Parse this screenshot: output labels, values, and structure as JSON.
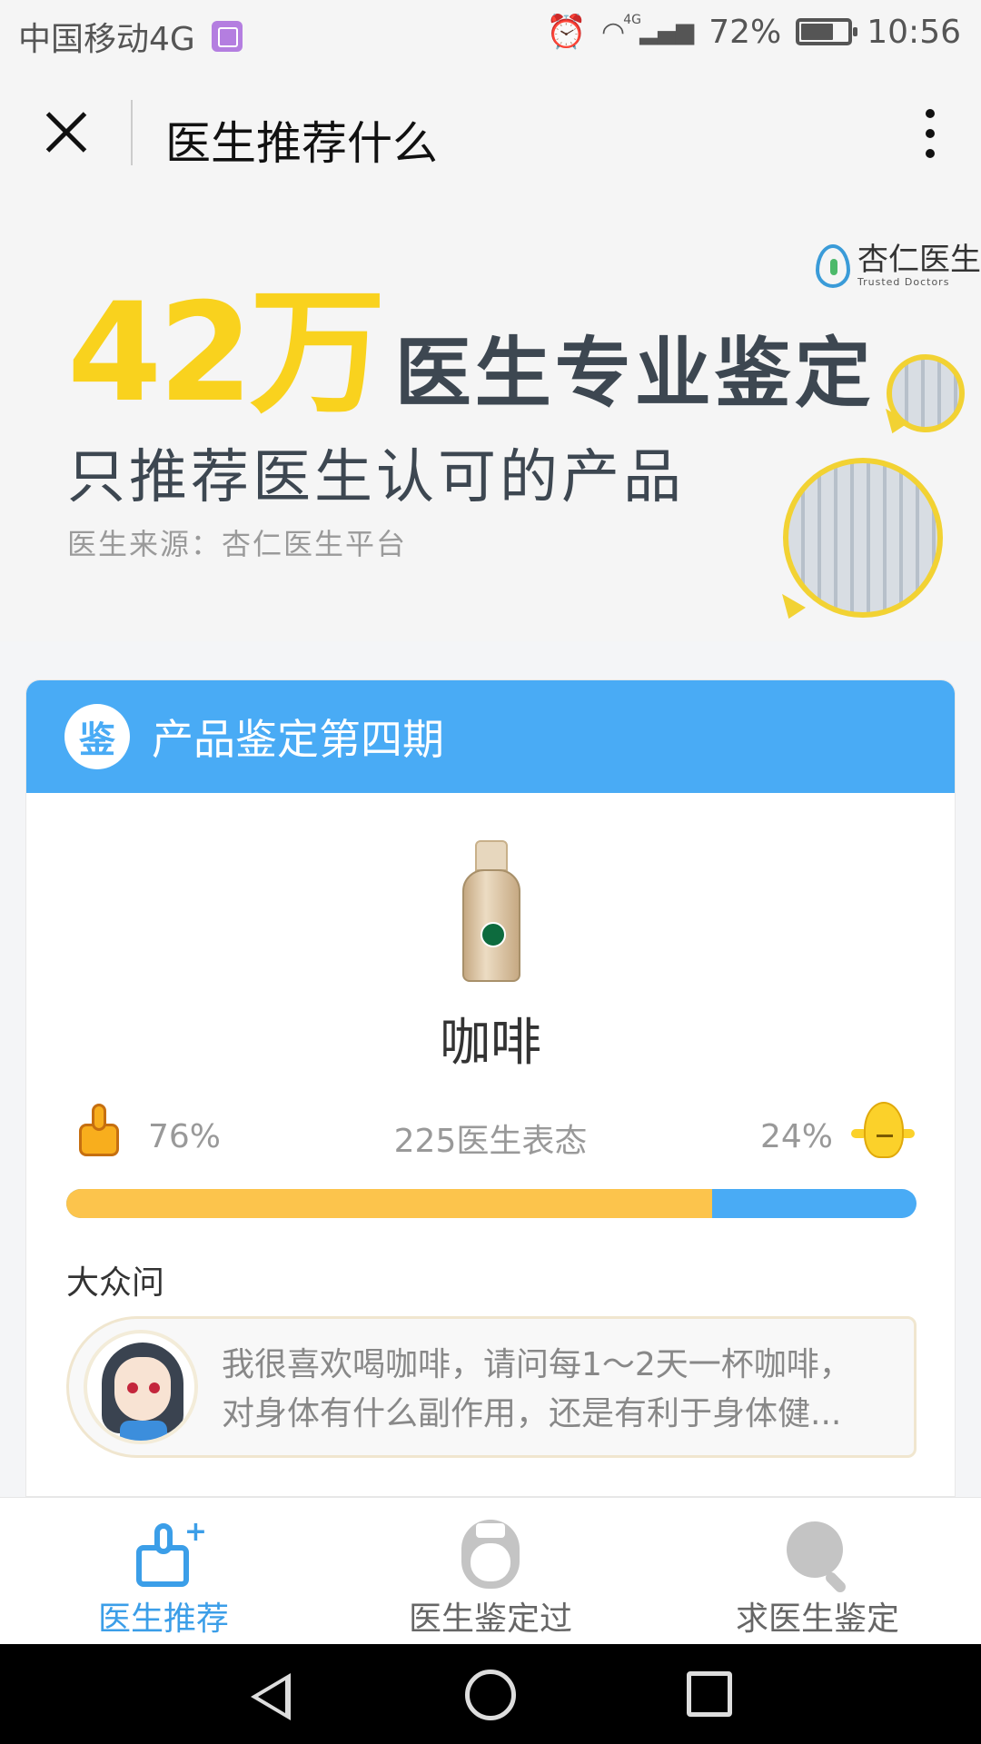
{
  "status_bar": {
    "carrier": "中国移动4G",
    "network": "4G",
    "battery": "72%",
    "battery_level": 0.72,
    "time": "10:56",
    "icons": [
      "image-icon",
      "alarm-icon",
      "wifi-icon",
      "signal-icon",
      "battery-icon"
    ]
  },
  "titlebar": {
    "title": "医生推荐什么",
    "close_icon": "close-icon",
    "more_icon": "more-vertical-icon"
  },
  "banner": {
    "brand_cn": "杏仁医生",
    "brand_en": "Trusted Doctors",
    "big_number": "42万",
    "big_text": "医生专业鉴定",
    "subtitle": "只推荐医生认可的产品",
    "source": "医生来源：杏仁医生平台"
  },
  "card": {
    "seal_char": "鉴",
    "title": "产品鉴定第四期",
    "product_name": "咖啡",
    "approve_pct": "76%",
    "approve_value": 0.76,
    "total_votes": "225医生表态",
    "disapprove_pct": "24%",
    "public_label": "大众问",
    "question_line1": "我很喜欢喝咖啡，请问每1～2天一杯咖啡，",
    "question_line2": "对身体有什么副作用，还是有利于身体健..."
  },
  "tabs": [
    {
      "label": "医生推荐",
      "icon": "thumbs-up-plus-icon",
      "active": true
    },
    {
      "label": "医生鉴定过",
      "icon": "doctor-icon",
      "active": false
    },
    {
      "label": "求医生鉴定",
      "icon": "search-icon",
      "active": false
    }
  ],
  "colors": {
    "accent": "#49abf5",
    "approve": "#fcc44c",
    "banner_number": "#f9d21e"
  }
}
